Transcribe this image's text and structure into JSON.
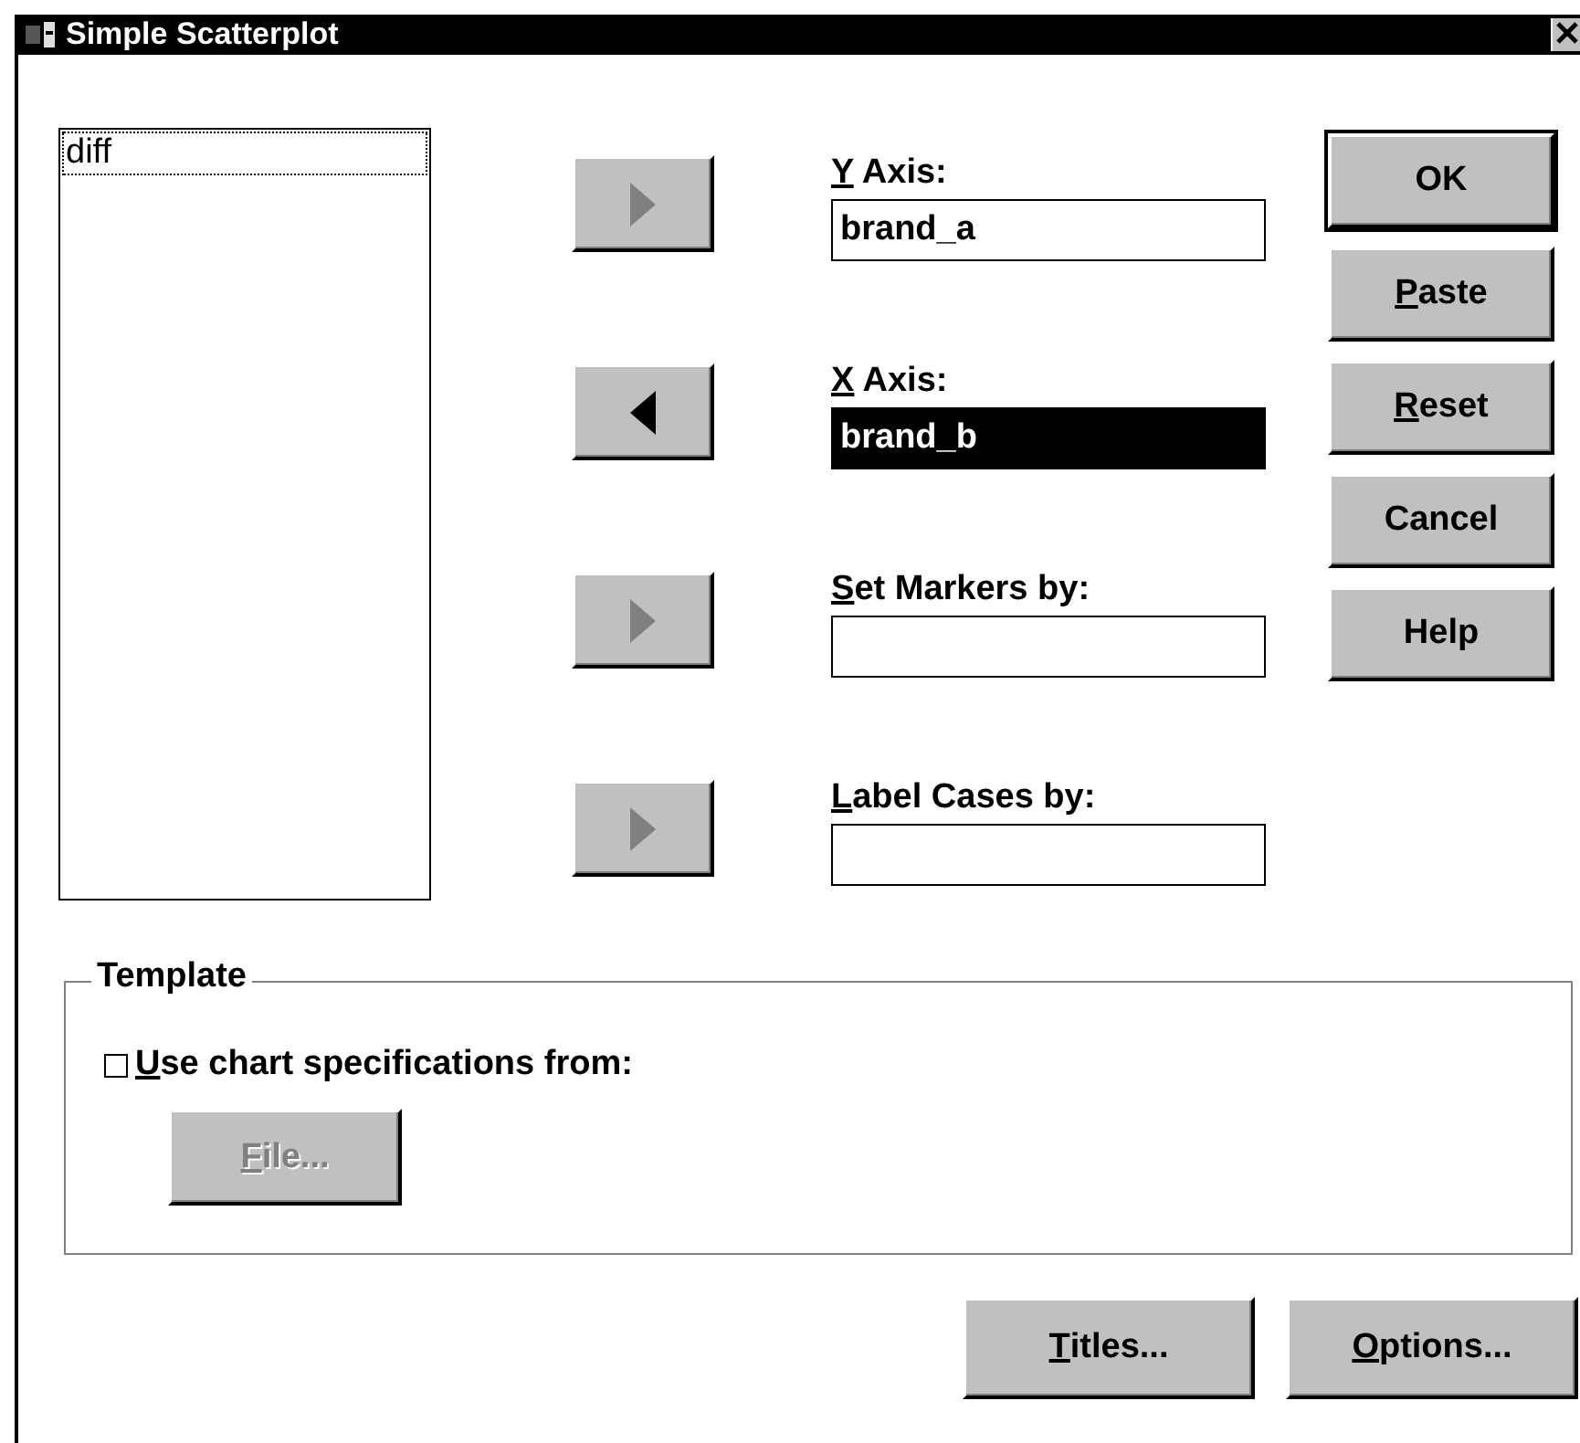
{
  "window": {
    "title": "Simple Scatterplot"
  },
  "variables": [
    {
      "name": "diff",
      "focused": true
    }
  ],
  "move_buttons": [
    {
      "kind": "right",
      "disabled": true
    },
    {
      "kind": "left",
      "disabled": false
    },
    {
      "kind": "right",
      "disabled": true
    },
    {
      "kind": "right",
      "disabled": true
    }
  ],
  "targets": [
    {
      "label": "Y Axis:",
      "mnemonic": true,
      "value": "brand_a",
      "selected": false
    },
    {
      "label": "X Axis:",
      "mnemonic": true,
      "value": "brand_b",
      "selected": true
    },
    {
      "label": "Set Markers by:",
      "mnemonic": true,
      "selected": false
    },
    {
      "label": "Label Cases by:",
      "mnemonic": true,
      "selected": false
    }
  ],
  "actions": [
    {
      "label": "OK",
      "default": true,
      "mnemonic": false
    },
    {
      "label": "Paste",
      "mnemonic": true,
      "default": false
    },
    {
      "label": "Reset",
      "mnemonic": true,
      "default": false
    },
    {
      "label": "Cancel",
      "default": false,
      "mnemonic": false
    },
    {
      "label": "Help",
      "default": false,
      "mnemonic": false
    }
  ],
  "template": {
    "title": "Template",
    "checkbox": {
      "label": "Use chart specifications from:",
      "mnemonic": true,
      "checked": false
    },
    "file_button": {
      "label": "File...",
      "mnemonic": true,
      "disabled": true
    }
  },
  "bottom_buttons": [
    {
      "label": "Titles...",
      "mnemonic": true
    },
    {
      "label": "Options...",
      "mnemonic": true
    }
  ]
}
